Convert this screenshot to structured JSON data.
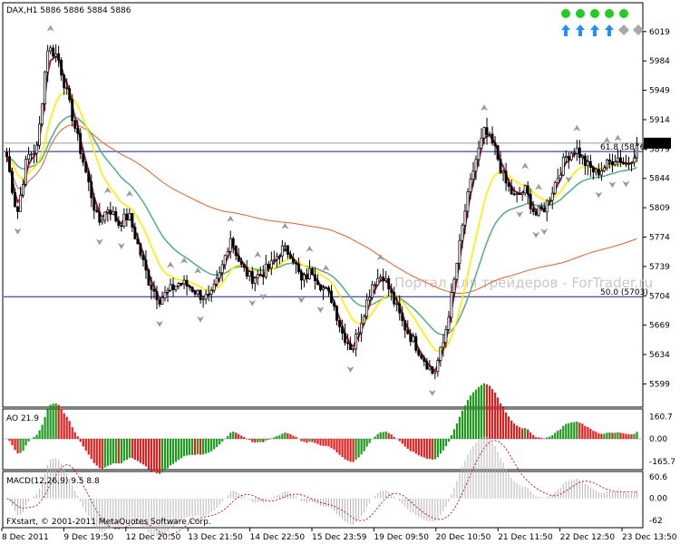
{
  "chart_data": {
    "type": "candlestick",
    "symbol_header": "DAX,H1  5886 5886 5884 5886",
    "watermark": "Портал для трейдеров - ForTrader.ru",
    "copyright": "FXstart, © 2001-2011 MetaQuotes Software Corp.",
    "ylim": [
      5580,
      6035
    ],
    "y_ticks": [
      "6019",
      "5984",
      "5949",
      "5914",
      "5879",
      "5844",
      "5809",
      "5774",
      "5739",
      "5704",
      "5669",
      "5634",
      "5599"
    ],
    "current_price": "5886",
    "x_ticks": [
      "8 Dec 2011",
      "9 Dec 19:50",
      "12 Dec 20:50",
      "13 Dec 21:50",
      "14 Dec 22:50",
      "15 Dec 23:59",
      "19 Dec 09:50",
      "20 Dec 10:50",
      "21 Dec 11:50",
      "22 Dec 12:50",
      "23 Dec 13:50"
    ],
    "levels": [
      {
        "label": "61.8 (5876)",
        "value": 5876
      },
      {
        "label": "50.0 (5703)",
        "value": 5703
      }
    ],
    "price_anchors": [
      5870,
      5800,
      5870,
      5880,
      6000,
      5990,
      5940,
      5890,
      5840,
      5790,
      5810,
      5790,
      5800,
      5760,
      5720,
      5700,
      5710,
      5720,
      5715,
      5705,
      5700,
      5730,
      5775,
      5740,
      5725,
      5730,
      5740,
      5760,
      5755,
      5720,
      5735,
      5715,
      5700,
      5660,
      5640,
      5680,
      5720,
      5730,
      5700,
      5670,
      5650,
      5630,
      5610,
      5650,
      5720,
      5800,
      5860,
      5900,
      5880,
      5840,
      5820,
      5830,
      5800,
      5810,
      5840,
      5870,
      5880,
      5860,
      5850,
      5860,
      5870,
      5860,
      5880
    ],
    "indicators": {
      "ao": {
        "label": "AO 21.9",
        "ticks": [
          "160.7",
          "0.00",
          "-165.7"
        ],
        "ylim": [
          -185,
          185
        ]
      },
      "macd": {
        "label": "MACD(12,26,9) 9.5 8.8",
        "ticks": [
          "60.6",
          "0.00",
          "-62"
        ],
        "ylim": [
          -62,
          60.6
        ]
      }
    },
    "signals": {
      "dot_count": 5,
      "up_arrow_count": 4,
      "diamond_count": 2
    }
  }
}
